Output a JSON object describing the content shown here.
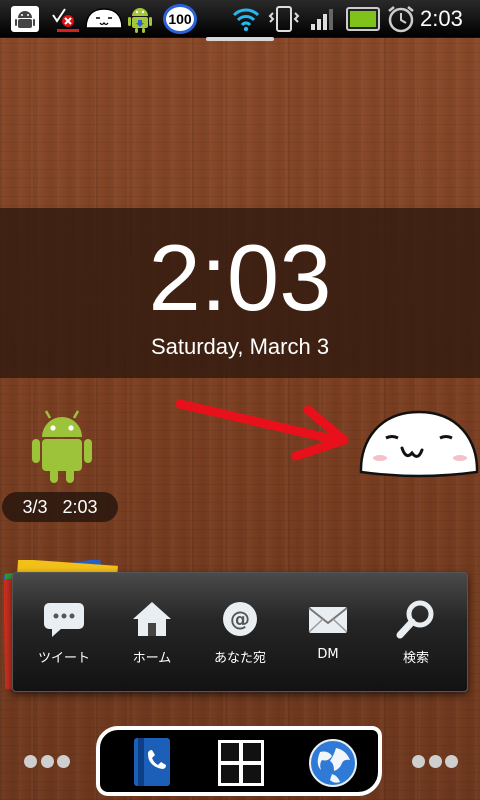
{
  "status_bar": {
    "time": "2:03",
    "badge_count": "100",
    "notification_icons": [
      "android-debug-icon",
      "blocked-update-icon",
      "mochi-notification-icon",
      "android-download-icon",
      "counter-badge-icon"
    ],
    "system_icons": [
      "wifi-icon",
      "vibrate-icon",
      "signal-icon",
      "battery-icon",
      "alarm-icon"
    ]
  },
  "lock_clock": {
    "time": "2:03",
    "date": "Saturday, March 3"
  },
  "android_widget": {
    "date": "3/3",
    "time": "2:03"
  },
  "twitter_toolbar": {
    "buttons": [
      {
        "label": "ツイート",
        "icon": "speech-bubble-icon"
      },
      {
        "label": "ホーム",
        "icon": "home-icon"
      },
      {
        "label": "あなた宛",
        "icon": "at-icon"
      },
      {
        "label": "DM",
        "icon": "mail-icon"
      },
      {
        "label": "検索",
        "icon": "search-icon"
      }
    ]
  },
  "dock": {
    "items": [
      "phone-book-icon",
      "app-grid-icon",
      "browser-globe-icon"
    ]
  },
  "colors": {
    "wood": "#7b3f22",
    "clock_band": "#2d180e",
    "arrow": "#e8101a",
    "android_green": "#a4c639",
    "badge_ring": "#2a62d8"
  }
}
